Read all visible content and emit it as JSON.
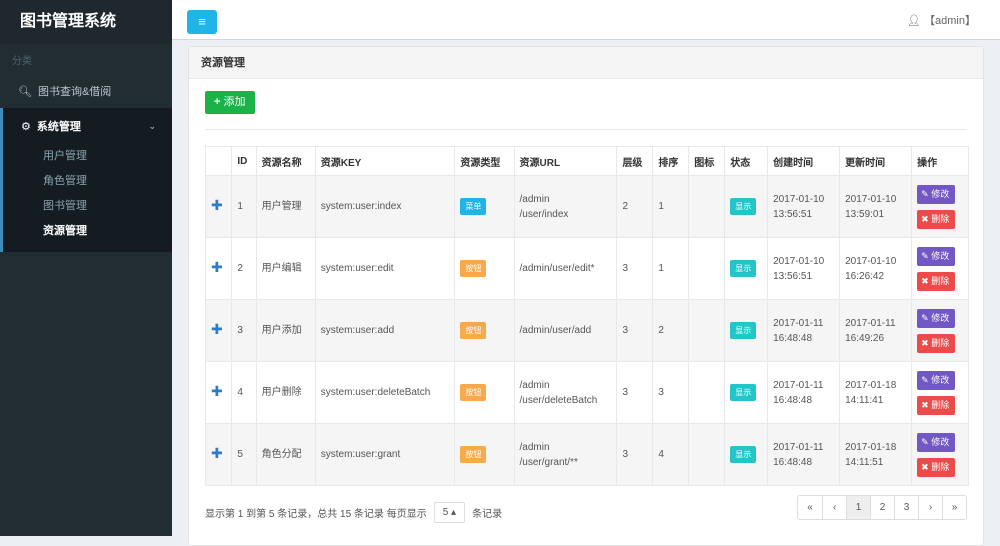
{
  "app": {
    "title": "图书管理系统",
    "category": "分类"
  },
  "sidebar": {
    "search_item": "图书查询&借阅",
    "menu": "系统管理",
    "subs": [
      "用户管理",
      "角色管理",
      "图书管理",
      "资源管理"
    ]
  },
  "topbar": {
    "user": "【admin】"
  },
  "panel": {
    "title": "资源管理",
    "add_label": "添加"
  },
  "table": {
    "headers": [
      "",
      "ID",
      "资源名称",
      "资源KEY",
      "资源类型",
      "资源URL",
      "层级",
      "排序",
      "图标",
      "状态",
      "创建时间",
      "更新时间",
      "操作"
    ],
    "rows": [
      {
        "id": "1",
        "name": "用户管理",
        "key": "system:user:index",
        "type": "菜单",
        "type_color": "#1fb5e6",
        "url": "/admin\n/user/index",
        "level": "2",
        "sort": "1",
        "icon": "",
        "status": "显示",
        "created": "2017-01-10\n13:56:51",
        "updated": "2017-01-10\n13:59:01"
      },
      {
        "id": "2",
        "name": "用户编辑",
        "key": "system:user:edit",
        "type": "按钮",
        "type_color": "#f8a94a",
        "url": "/admin/user/edit*",
        "level": "3",
        "sort": "1",
        "icon": "",
        "status": "显示",
        "created": "2017-01-10\n13:56:51",
        "updated": "2017-01-10\n16:26:42"
      },
      {
        "id": "3",
        "name": "用户添加",
        "key": "system:user:add",
        "type": "按钮",
        "type_color": "#f8a94a",
        "url": "/admin/user/add",
        "level": "3",
        "sort": "2",
        "icon": "",
        "status": "显示",
        "created": "2017-01-11\n16:48:48",
        "updated": "2017-01-11\n16:49:26"
      },
      {
        "id": "4",
        "name": "用户删除",
        "key": "system:user:deleteBatch",
        "type": "按钮",
        "type_color": "#f8a94a",
        "url": "/admin\n/user/deleteBatch",
        "level": "3",
        "sort": "3",
        "icon": "",
        "status": "显示",
        "created": "2017-01-11\n16:48:48",
        "updated": "2017-01-18\n14:11:41"
      },
      {
        "id": "5",
        "name": "角色分配",
        "key": "system:user:grant",
        "type": "按钮",
        "type_color": "#f8a94a",
        "url": "/admin\n/user/grant/**",
        "level": "3",
        "sort": "4",
        "icon": "",
        "status": "显示",
        "created": "2017-01-11\n16:48:48",
        "updated": "2017-01-18\n14:11:51"
      }
    ],
    "edit_label": "修改",
    "delete_label": "删除",
    "status_color": "#23c6c8"
  },
  "footer": {
    "info": "显示第 1 到第 5 条记录，总共 15 条记录 每页显示",
    "page_size": "5",
    "suffix": "条记录"
  },
  "pager": [
    "«",
    "‹",
    "1",
    "2",
    "3",
    "›",
    "»"
  ],
  "pager_current": "1"
}
